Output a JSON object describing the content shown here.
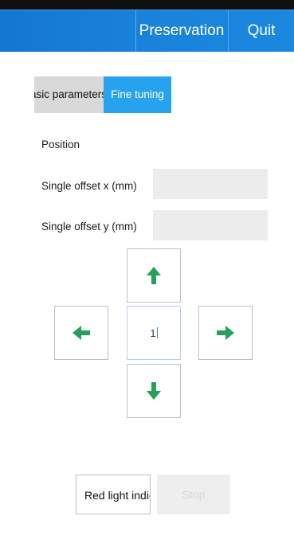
{
  "header": {
    "save_label": "Preservation",
    "quit_label": "Quit"
  },
  "tabs": {
    "basic_label": "Basic parameters",
    "fine_label": "Fine tuning"
  },
  "form": {
    "position_label": "Position",
    "offset_x_label": "Single offset x (mm)",
    "offset_x_value": "",
    "offset_y_label": "Single offset y (mm)",
    "offset_y_value": ""
  },
  "pad": {
    "step_value": "1",
    "up_icon": "arrow-up-icon",
    "down_icon": "arrow-down-icon",
    "left_icon": "arrow-left-icon",
    "right_icon": "arrow-right-icon",
    "arrow_color": "#27a05a"
  },
  "actions": {
    "light_label": "Red light indication",
    "stop_label": "Stop"
  },
  "colors": {
    "header_bg": "#1a84dc",
    "active_tab": "#27a2ef",
    "inactive_tab": "#d9d9d9"
  }
}
